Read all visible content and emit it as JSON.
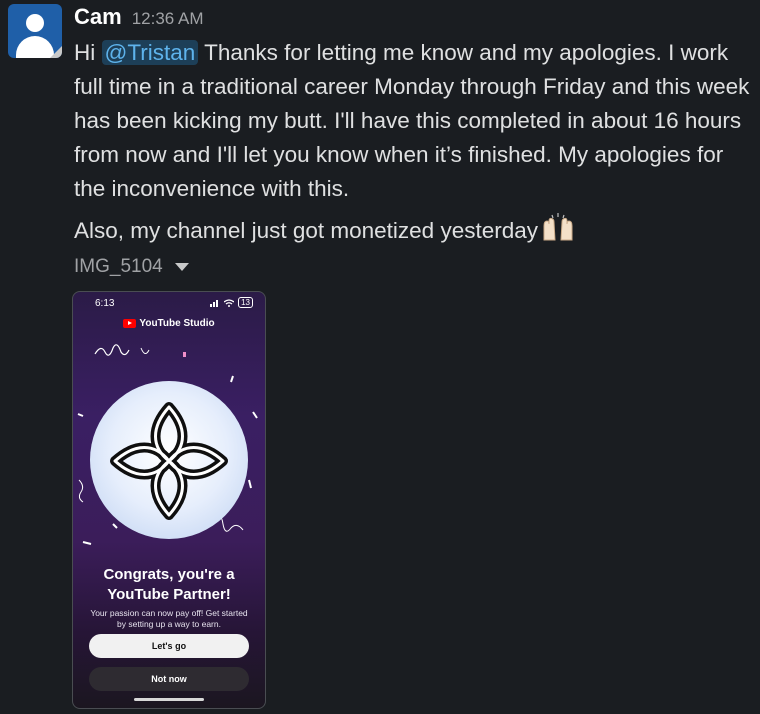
{
  "message": {
    "author": "Cam",
    "time": "12:36 AM",
    "greeting": "Hi",
    "mention": "@Tristan",
    "body": " Thanks for letting me know and my apologies. I work full time in a traditional career Monday through Friday and this week has been kicking my butt. I'll have this completed in about 16 hours from now and I'll let you know when it’s finished. My apologies for the inconvenience with this.",
    "body2": "Also, my channel just got monetized yesterday",
    "emoji": "raised-hands-icon"
  },
  "attachment": {
    "name": "IMG_5104"
  },
  "phone": {
    "clock": "6:13",
    "battery": "13",
    "app_title": "YouTube Studio",
    "headline_line1": "Congrats, you're a",
    "headline_line2": "YouTube Partner!",
    "subtext": "Your passion can now pay off! Get started by setting up a way to earn.",
    "primary_button": "Let's go",
    "secondary_button": "Not now"
  },
  "colors": {
    "background": "#1a1d21",
    "mention_bg": "#1d3f58",
    "mention_text": "#5eb3ec",
    "avatar": "#1f5fa8"
  }
}
